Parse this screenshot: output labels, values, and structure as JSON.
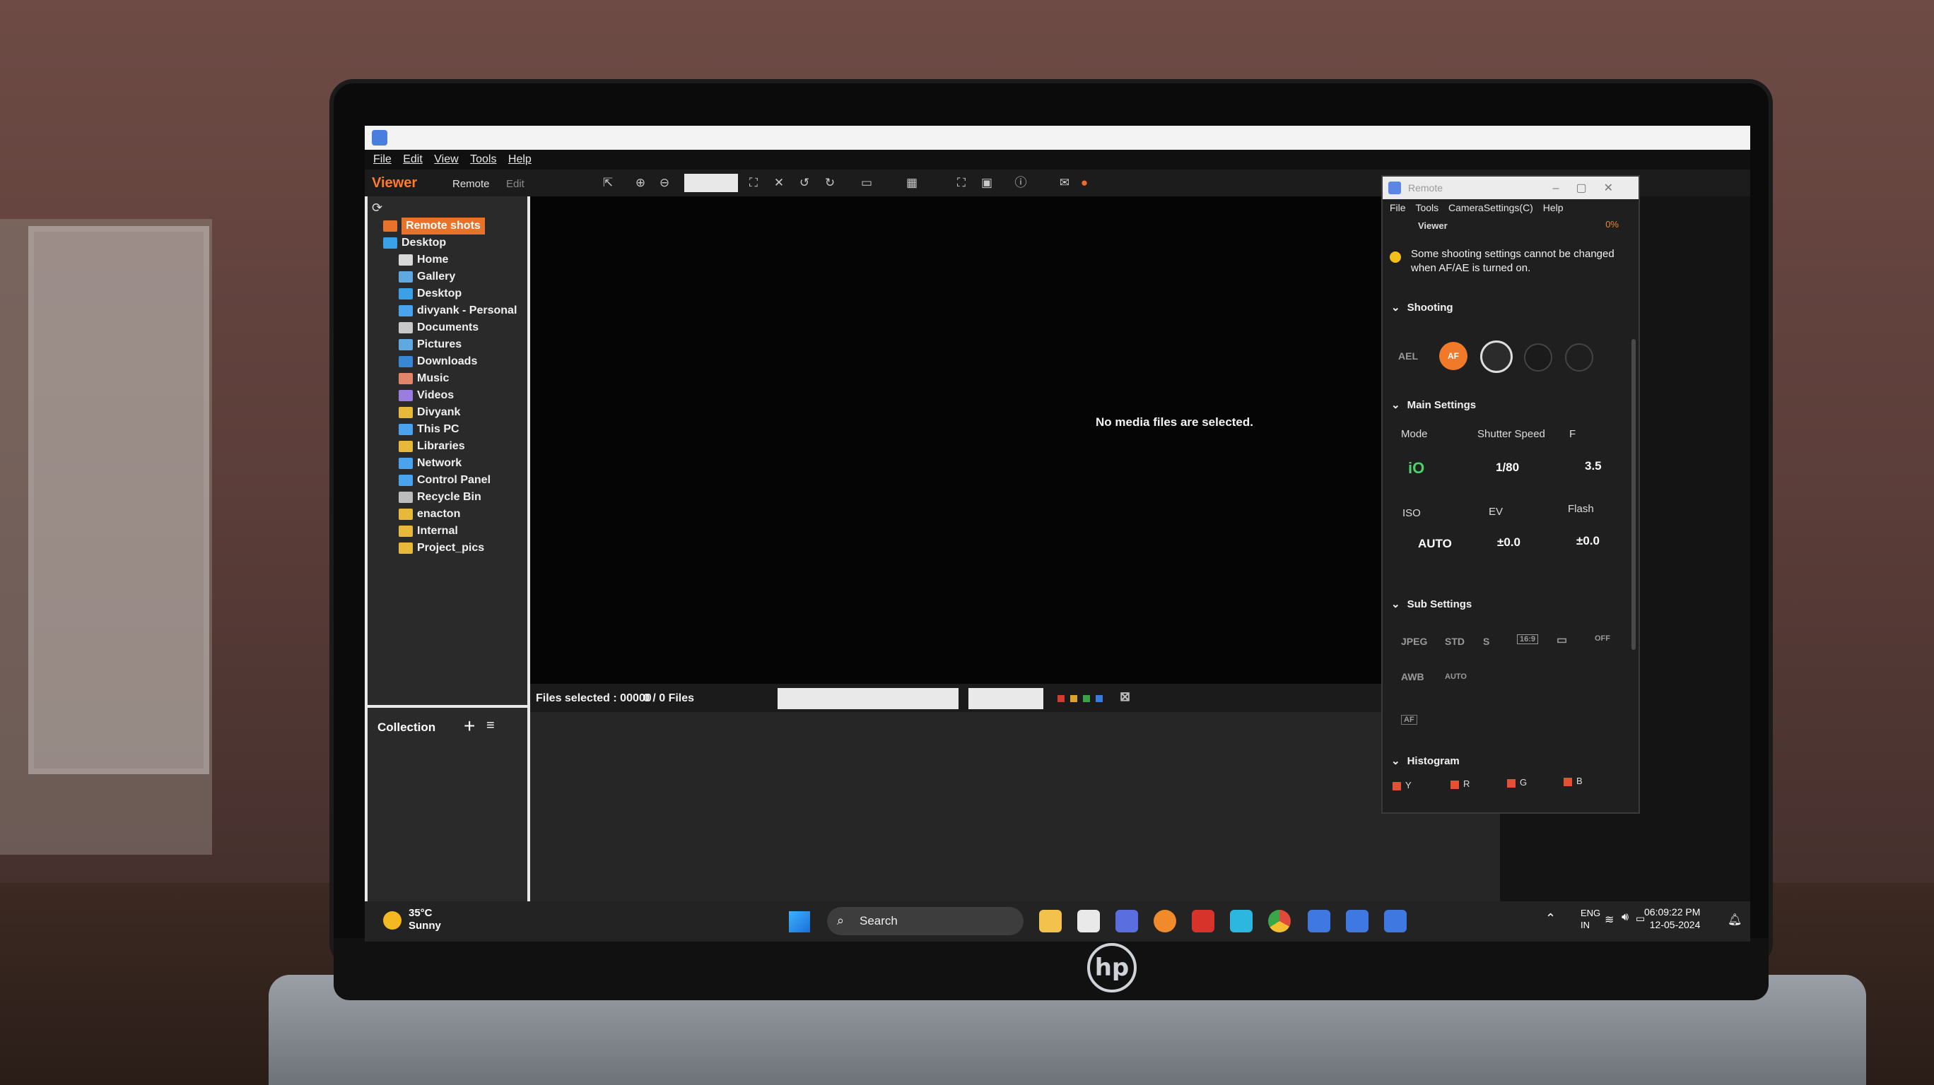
{
  "menu": [
    "File",
    "Edit",
    "View",
    "Tools",
    "Help"
  ],
  "toolbar": {
    "viewer": "Viewer",
    "remote": "Remote",
    "edit": "Edit"
  },
  "sidebar": {
    "items": [
      {
        "label": "Remote shots",
        "highlight": true,
        "color": "#e8722a"
      },
      {
        "label": "Desktop",
        "color": "#3aa0e8"
      },
      {
        "label": "Home",
        "color": "#d8d8d8"
      },
      {
        "label": "Gallery",
        "color": "#5fa8e0"
      },
      {
        "label": "Desktop",
        "color": "#3aa0e8"
      },
      {
        "label": "divyank - Personal",
        "color": "#4aa3ef"
      },
      {
        "label": "Documents",
        "color": "#c9c9c9"
      },
      {
        "label": "Pictures",
        "color": "#5fa8e0"
      },
      {
        "label": "Downloads",
        "color": "#3a86d6"
      },
      {
        "label": "Music",
        "color": "#e0856a"
      },
      {
        "label": "Videos",
        "color": "#9b7de0"
      },
      {
        "label": "Divyank",
        "color": "#e6b93a"
      },
      {
        "label": "This PC",
        "color": "#4aa3ef"
      },
      {
        "label": "Libraries",
        "color": "#e6b93a"
      },
      {
        "label": "Network",
        "color": "#4aa3ef"
      },
      {
        "label": "Control Panel",
        "color": "#4aa3ef"
      },
      {
        "label": "Recycle Bin",
        "color": "#bdbdbd"
      },
      {
        "label": "enacton",
        "color": "#e6b93a"
      },
      {
        "label": "Internal",
        "color": "#e6b93a"
      },
      {
        "label": "Project_pics",
        "color": "#e6b93a"
      }
    ],
    "collection": "Collection"
  },
  "viewer": {
    "empty_message": "No media files are selected."
  },
  "status": {
    "files_selected": "Files selected : 00000",
    "files_count": "0 / 0 Files"
  },
  "remote": {
    "title": "Remote",
    "menu": [
      "File",
      "Tools",
      "CameraSettings(C)",
      "Help"
    ],
    "viewer": "Viewer",
    "battery": "0%",
    "warning": "Some shooting settings cannot be changed when AF/AE is turned on.",
    "sections": {
      "shooting": "Shooting",
      "main": "Main Settings",
      "sub": "Sub Settings",
      "histogram": "Histogram"
    },
    "ael": "AEL",
    "af": "AF",
    "labels": {
      "mode": "Mode",
      "shutter": "Shutter Speed",
      "f": "F",
      "iso": "ISO",
      "ev": "EV",
      "flash": "Flash"
    },
    "values": {
      "shutter": "1/80",
      "f": "3.5",
      "iso": "AUTO",
      "ev": "±0.0",
      "flash": "±0.0"
    },
    "sub_items": [
      "JPEG",
      "STD",
      "S",
      "16:9",
      "AWB",
      "AUTO",
      "OFF"
    ],
    "histogram": [
      "Y",
      "R",
      "G",
      "B"
    ]
  },
  "taskbar": {
    "temp": "35°C",
    "condition": "Sunny",
    "search": "Search",
    "lang1": "ENG",
    "lang2": "IN",
    "time": "06:09:22 PM",
    "date": "12-05-2024"
  }
}
